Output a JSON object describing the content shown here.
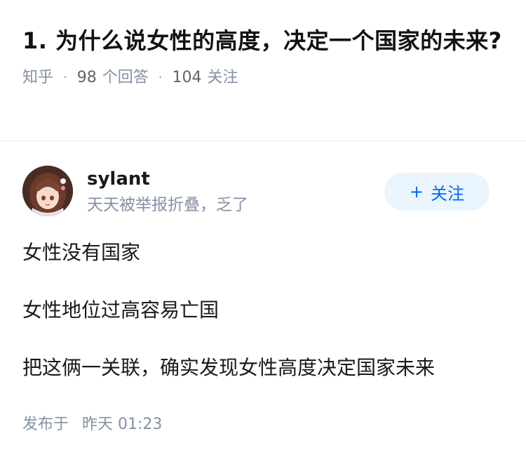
{
  "question": {
    "title": "1. 为什么说女性的高度，决定一个国家的未来?",
    "source": "知乎",
    "answers_count": "98",
    "answers_label": "个回答",
    "followers_count": "104",
    "followers_label": "关注"
  },
  "author": {
    "name": "sylant",
    "bio": "天天被举报折叠，乏了",
    "avatar_icon": "anime-avatar-icon",
    "follow_plus": "+",
    "follow_label": "关注"
  },
  "answer": {
    "paragraphs": [
      "女性没有国家",
      "女性地位过高容易亡国",
      "把这俩一关联，确实发现女性高度决定国家未来"
    ],
    "publish_label": "发布于",
    "publish_time": "昨天 01:23"
  },
  "colors": {
    "muted": "#8590a6",
    "accent": "#0066ff",
    "button_bg": "#ebf5fd"
  }
}
